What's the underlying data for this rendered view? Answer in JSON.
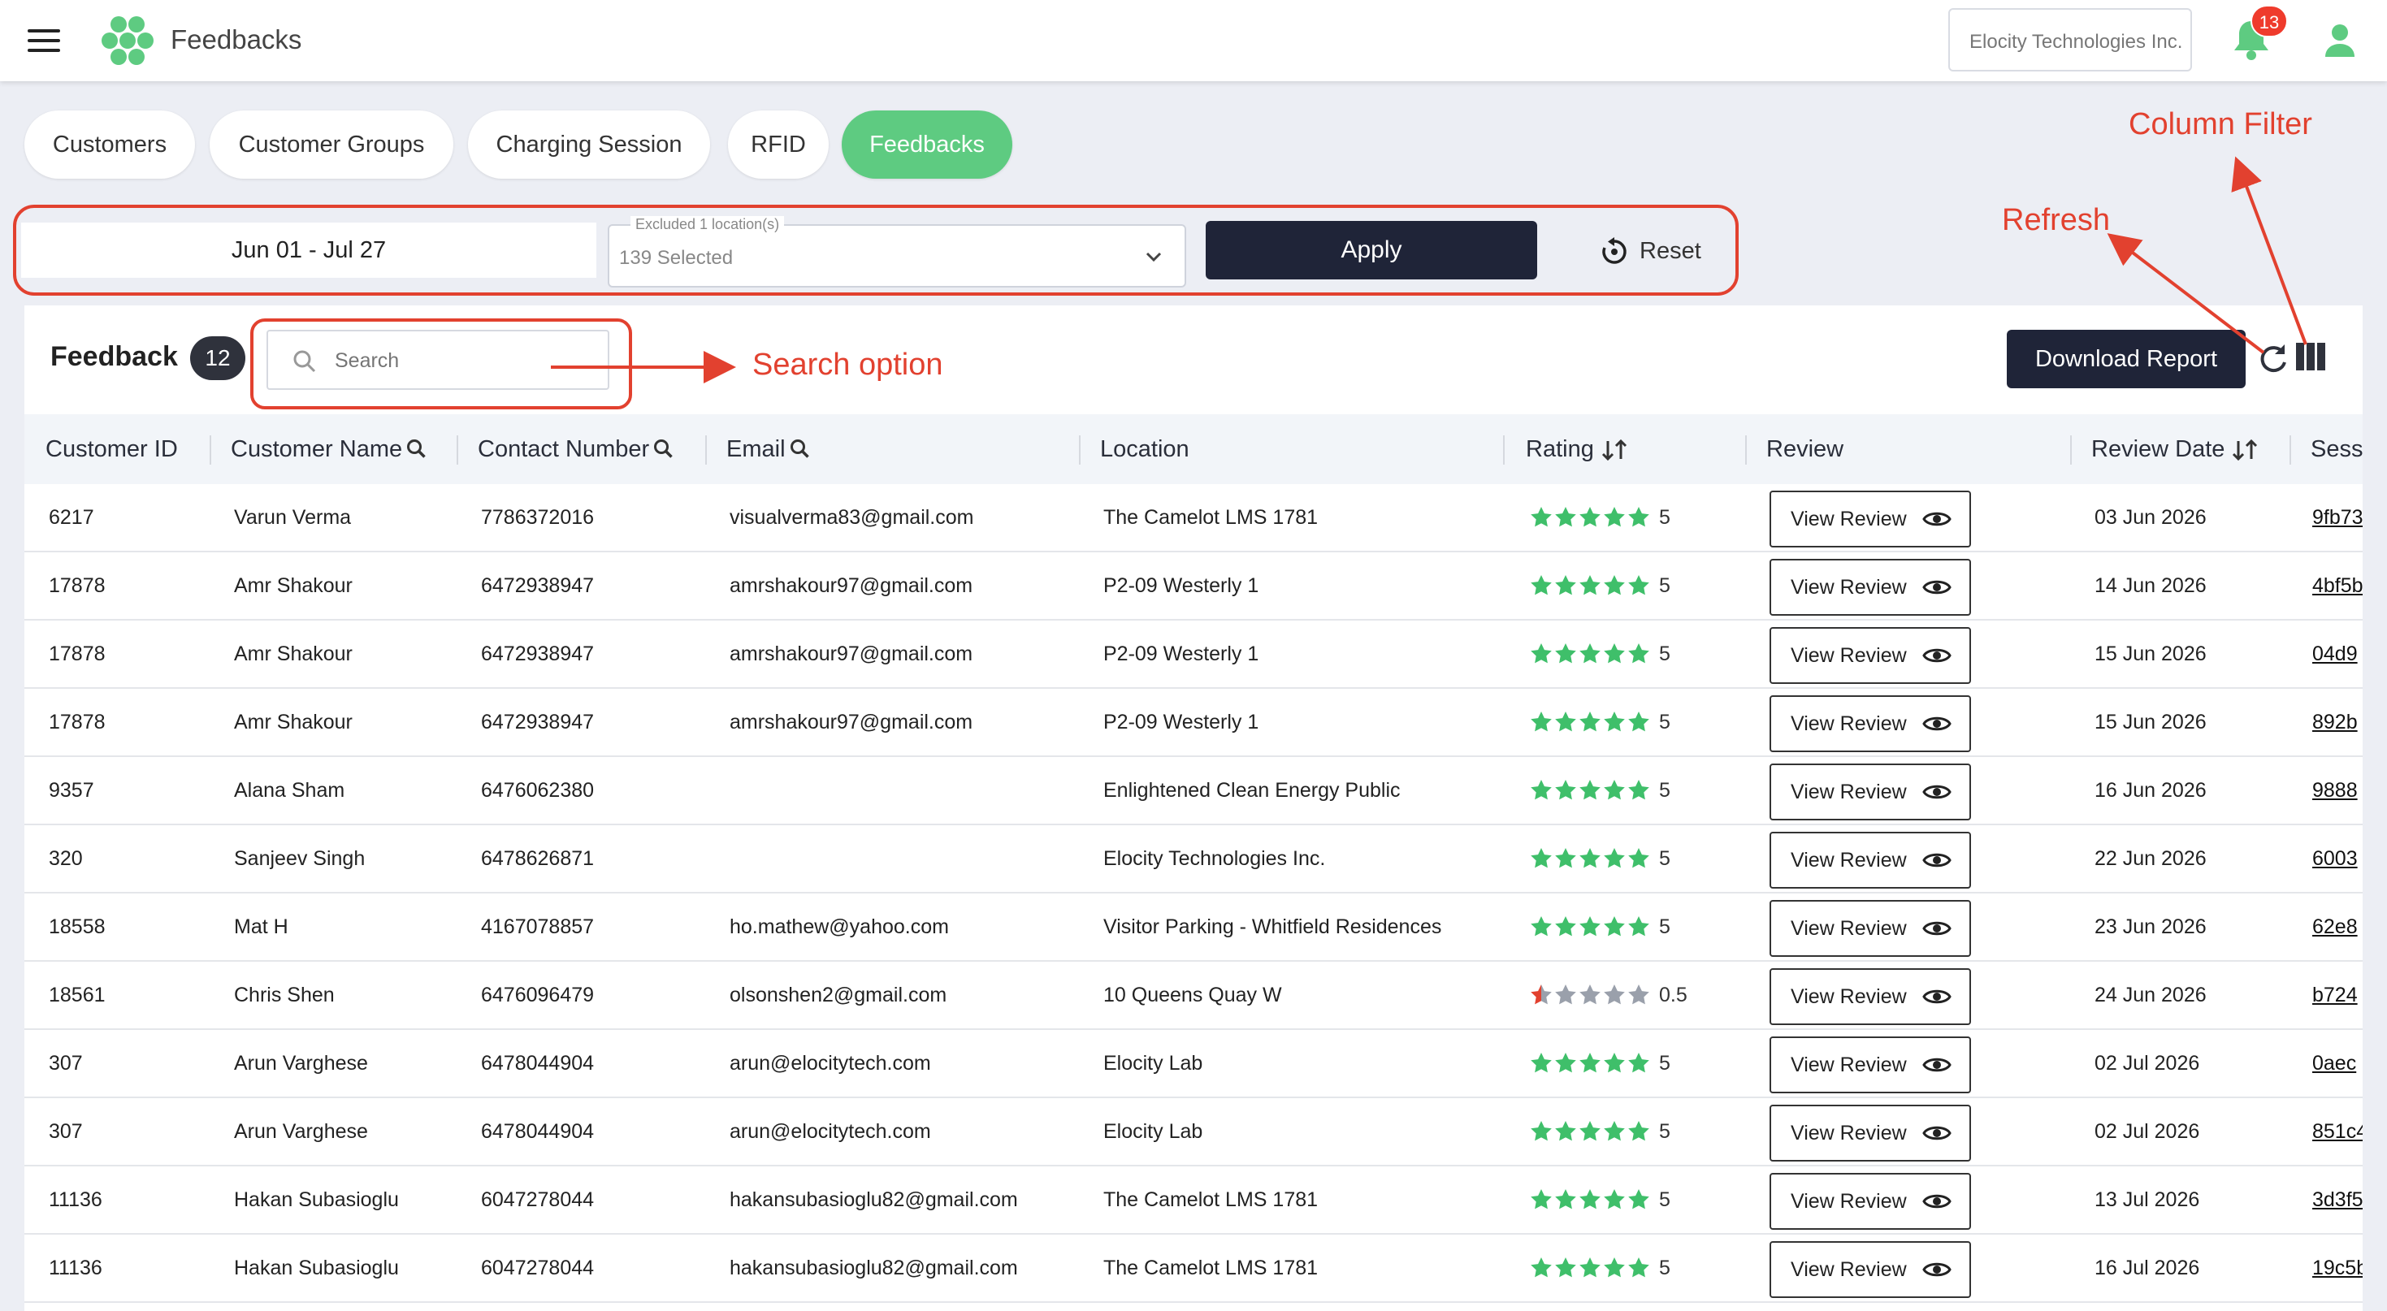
{
  "app": {
    "title": "Feedbacks",
    "organization": "Elocity Technologies Inc.",
    "notification_count": "13"
  },
  "tabs": [
    {
      "label": "Customers",
      "active": false
    },
    {
      "label": "Customer Groups",
      "active": false
    },
    {
      "label": "Charging Session",
      "active": false
    },
    {
      "label": "RFID",
      "active": false
    },
    {
      "label": "Feedbacks",
      "active": true
    }
  ],
  "filters": {
    "date_range": "Jun 01 - Jul 27",
    "location_legend": "Excluded 1 location(s)",
    "location_value": "139 Selected",
    "apply_label": "Apply",
    "reset_label": "Reset"
  },
  "panel": {
    "title": "Feedback",
    "count": "12",
    "search_placeholder": "Search",
    "download_label": "Download Report"
  },
  "table": {
    "columns": [
      "Customer ID",
      "Customer Name",
      "Contact Number",
      "Email",
      "Location",
      "Rating",
      "Review",
      "Review Date",
      "Sess"
    ],
    "view_label": "View Review",
    "rows": [
      {
        "id": "6217",
        "name": "Varun Verma",
        "contact": "7786372016",
        "email": "visualverma83@gmail.com",
        "location": "The Camelot LMS 1781",
        "rating": 5,
        "rating_text": "5",
        "date": "03 Jun 2026",
        "session": "9fb73"
      },
      {
        "id": "17878",
        "name": "Amr Shakour",
        "contact": "6472938947",
        "email": "amrshakour97@gmail.com",
        "location": "P2-09 Westerly 1",
        "rating": 5,
        "rating_text": "5",
        "date": "14 Jun 2026",
        "session": "4bf5b"
      },
      {
        "id": "17878",
        "name": "Amr Shakour",
        "contact": "6472938947",
        "email": "amrshakour97@gmail.com",
        "location": "P2-09 Westerly 1",
        "rating": 5,
        "rating_text": "5",
        "date": "15 Jun 2026",
        "session": "04d9"
      },
      {
        "id": "17878",
        "name": "Amr Shakour",
        "contact": "6472938947",
        "email": "amrshakour97@gmail.com",
        "location": "P2-09 Westerly 1",
        "rating": 5,
        "rating_text": "5",
        "date": "15 Jun 2026",
        "session": "892b"
      },
      {
        "id": "9357",
        "name": "Alana Sham",
        "contact": "6476062380",
        "email": "",
        "location": "Enlightened Clean Energy Public",
        "rating": 5,
        "rating_text": "5",
        "date": "16 Jun 2026",
        "session": "9888"
      },
      {
        "id": "320",
        "name": "Sanjeev Singh",
        "contact": "6478626871",
        "email": "",
        "location": "Elocity Technologies Inc.",
        "rating": 5,
        "rating_text": "5",
        "date": "22 Jun 2026",
        "session": "6003"
      },
      {
        "id": "18558",
        "name": "Mat H",
        "contact": "4167078857",
        "email": "ho.mathew@yahoo.com",
        "location": "Visitor Parking - Whitfield Residences",
        "rating": 5,
        "rating_text": "5",
        "date": "23 Jun 2026",
        "session": "62e8"
      },
      {
        "id": "18561",
        "name": "Chris Shen",
        "contact": "6476096479",
        "email": "olsonshen2@gmail.com",
        "location": "10 Queens Quay W",
        "rating": 0.5,
        "rating_text": "0.5",
        "date": "24 Jun 2026",
        "session": "b724"
      },
      {
        "id": "307",
        "name": "Arun Varghese",
        "contact": "6478044904",
        "email": "arun@elocitytech.com",
        "location": "Elocity Lab",
        "rating": 5,
        "rating_text": "5",
        "date": "02 Jul 2026",
        "session": "0aec"
      },
      {
        "id": "307",
        "name": "Arun Varghese",
        "contact": "6478044904",
        "email": "arun@elocitytech.com",
        "location": "Elocity Lab",
        "rating": 5,
        "rating_text": "5",
        "date": "02 Jul 2026",
        "session": "851c4"
      },
      {
        "id": "11136",
        "name": "Hakan Subasioglu",
        "contact": "6047278044",
        "email": "hakansubasioglu82@gmail.com",
        "location": "The Camelot LMS 1781",
        "rating": 5,
        "rating_text": "5",
        "date": "13 Jul 2026",
        "session": "3d3f5"
      },
      {
        "id": "11136",
        "name": "Hakan Subasioglu",
        "contact": "6047278044",
        "email": "hakansubasioglu82@gmail.com",
        "location": "The Camelot LMS 1781",
        "rating": 5,
        "rating_text": "5",
        "date": "16 Jul 2026",
        "session": "19c5b"
      }
    ]
  },
  "annotations": {
    "column_filter": "Column Filter",
    "refresh": "Refresh",
    "search_option": "Search option"
  },
  "colors": {
    "accent_green": "#5ecb81",
    "dark_button": "#1f2438",
    "annotation_red": "#e2412f",
    "star_green": "#3fbf6a",
    "star_gray": "#9aa0ab",
    "star_red": "#e2412f"
  }
}
